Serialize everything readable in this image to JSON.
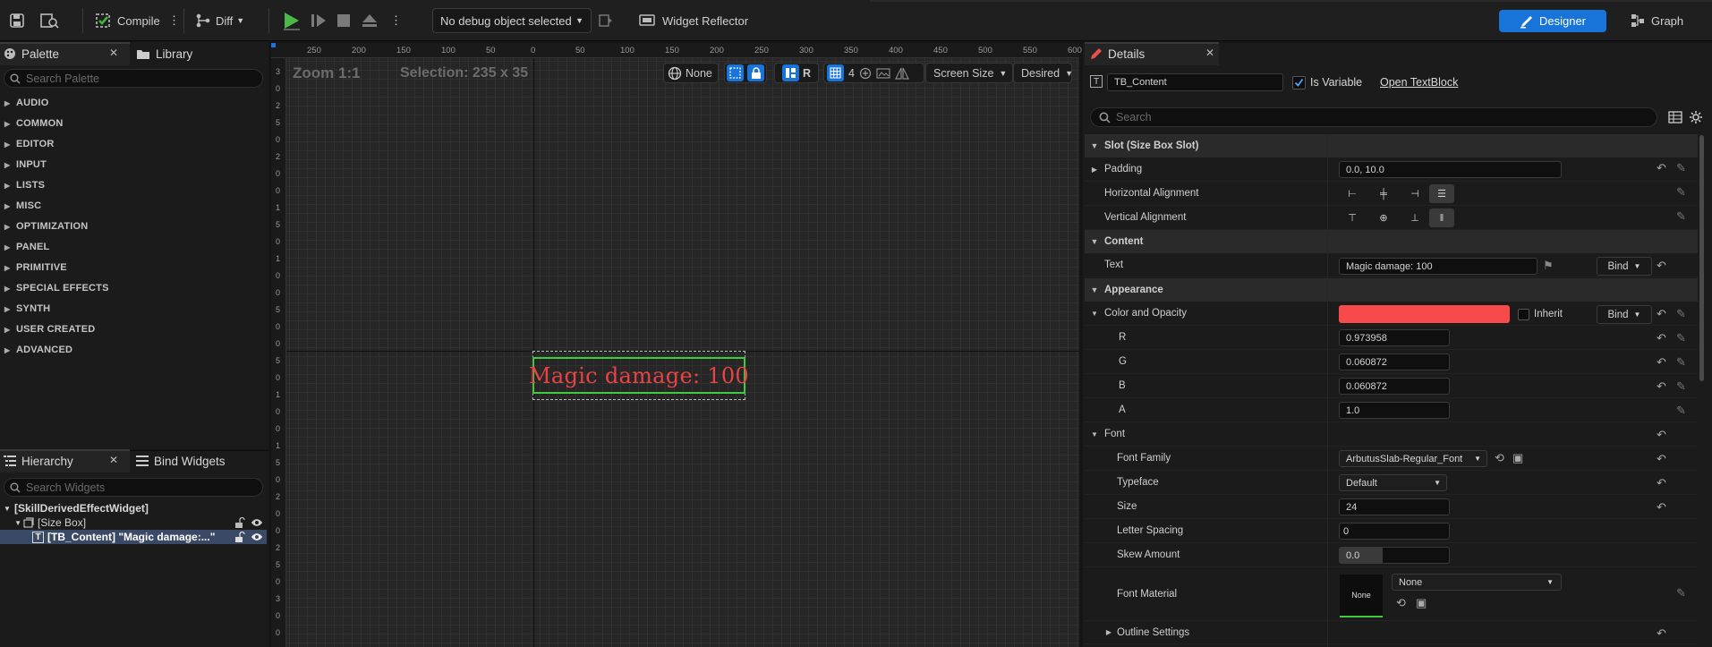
{
  "toolbar": {
    "compile_label": "Compile",
    "diff_label": "Diff",
    "debug_object": "No debug object selected",
    "widget_reflector_label": "Widget Reflector",
    "designer_label": "Designer",
    "graph_label": "Graph"
  },
  "palette": {
    "tab_label": "Palette",
    "library_tab_label": "Library",
    "search_placeholder": "Search Palette",
    "categories": [
      "AUDIO",
      "COMMON",
      "EDITOR",
      "INPUT",
      "LISTS",
      "MISC",
      "OPTIMIZATION",
      "PANEL",
      "PRIMITIVE",
      "SPECIAL EFFECTS",
      "SYNTH",
      "USER CREATED",
      "ADVANCED"
    ]
  },
  "hierarchy": {
    "tab_label": "Hierarchy",
    "bind_tab_label": "Bind Widgets",
    "search_placeholder": "Search Widgets",
    "root": "[SkillDerivedEffectWidget]",
    "size_box": "[Size Box]",
    "tb_content": "[TB_Content] \"Magic damage:...\""
  },
  "canvas": {
    "zoom": "Zoom 1:1",
    "selection": "Selection: 235 x 35",
    "none_label": "None",
    "r_label": "R",
    "grid_value": "4",
    "screen_size": "Screen Size",
    "desired": "Desired",
    "widget_text": "Magic damage: 100",
    "ruler_top": [
      "250",
      "200",
      "150",
      "100",
      "50",
      "0",
      "50",
      "100",
      "150",
      "200",
      "250",
      "300",
      "350",
      "400",
      "450",
      "500",
      "550",
      "600"
    ],
    "ruler_left": [
      "3",
      "0",
      "2",
      "5",
      "0",
      "2",
      "0",
      "0",
      "1",
      "5",
      "0",
      "1",
      "0",
      "0",
      "5",
      "0",
      "0",
      "5",
      "0",
      "1",
      "0",
      "0",
      "1",
      "5",
      "0",
      "2",
      "0",
      "0",
      "2",
      "5",
      "0",
      "3",
      "0",
      "0"
    ],
    "text_color": "#e84444",
    "selection_color": "#3fc93f"
  },
  "details": {
    "tab_label": "Details",
    "widget_name": "TB_Content",
    "is_variable_label": "Is Variable",
    "open_link": "Open TextBlock",
    "search_placeholder": "Search",
    "sec_slot": "Slot (Size Box Slot)",
    "padding_label": "Padding",
    "padding_value": "0.0, 10.0",
    "halign_label": "Horizontal Alignment",
    "valign_label": "Vertical Alignment",
    "sec_content": "Content",
    "text_label": "Text",
    "text_value": "Magic damage: 100",
    "bind_label": "Bind",
    "sec_appearance": "Appearance",
    "color_label": "Color and Opacity",
    "color_hex": "#f84a4a",
    "inherit_label": "Inherit",
    "r_label": "R",
    "r_value": "0.973958",
    "g_label": "G",
    "g_value": "0.060872",
    "b_label": "B",
    "b_value": "0.060872",
    "a_label": "A",
    "a_value": "1.0",
    "font_label": "Font",
    "font_family_label": "Font Family",
    "font_family_value": "ArbutusSlab-Regular_Font",
    "typeface_label": "Typeface",
    "typeface_value": "Default",
    "size_label": "Size",
    "size_value": "24",
    "letter_spacing_label": "Letter Spacing",
    "letter_spacing_value": "0",
    "skew_label": "Skew Amount",
    "skew_value": "0.0",
    "font_material_label": "Font Material",
    "font_material_thumb": "None",
    "font_material_value": "None",
    "outline_label": "Outline Settings"
  }
}
